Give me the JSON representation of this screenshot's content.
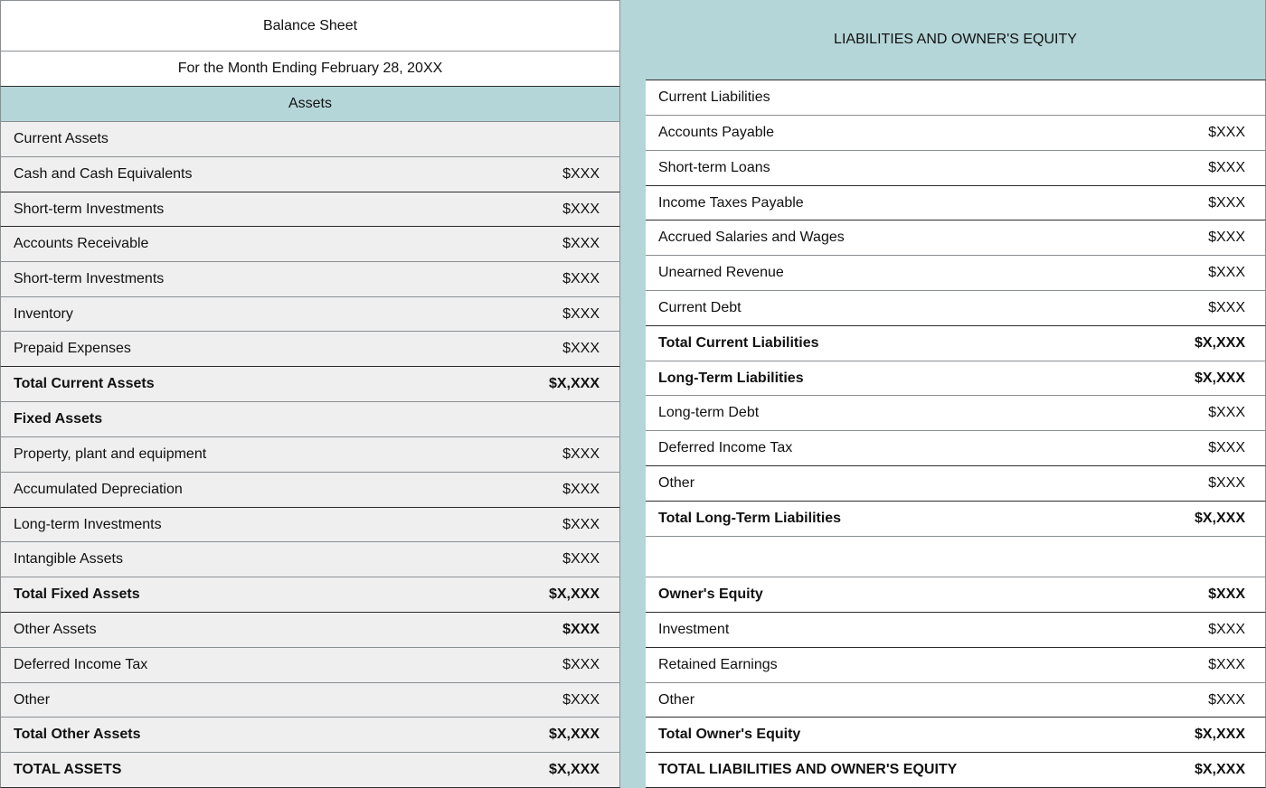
{
  "left": {
    "title": "Balance Sheet",
    "subtitle": "For the Month Ending February 28, 20XX",
    "section_header": "Assets",
    "rows": [
      {
        "label": "Current Assets",
        "value": ""
      },
      {
        "label": "Cash and Cash Equivalents",
        "value": "$XXX"
      },
      {
        "label": "Short-term Investments",
        "value": "$XXX"
      },
      {
        "label": "Accounts Receivable",
        "value": "$XXX"
      },
      {
        "label": "Short-term Investments",
        "value": "$XXX"
      },
      {
        "label": "Inventory",
        "value": "$XXX"
      },
      {
        "label": "Prepaid Expenses",
        "value": "$XXX"
      },
      {
        "label": "Total Current Assets",
        "value": "$X,XXX"
      },
      {
        "label": "Fixed Assets",
        "value": ""
      },
      {
        "label": "Property, plant and equipment",
        "value": "$XXX"
      },
      {
        "label": "Accumulated Depreciation",
        "value": "$XXX"
      },
      {
        "label": "Long-term Investments",
        "value": "$XXX"
      },
      {
        "label": "Intangible Assets",
        "value": "$XXX"
      },
      {
        "label": "Total Fixed Assets",
        "value": "$X,XXX"
      },
      {
        "label": "Other Assets",
        "value": "$XXX"
      },
      {
        "label": "Deferred Income Tax",
        "value": "$XXX"
      },
      {
        "label": "Other",
        "value": "$XXX"
      },
      {
        "label": "Total Other Assets",
        "value": "$X,XXX"
      },
      {
        "label": "TOTAL ASSETS",
        "value": "$X,XXX"
      }
    ]
  },
  "right": {
    "section_header": "LIABILITIES AND OWNER'S EQUITY",
    "rows": [
      {
        "label": "Current Liabilities",
        "value": ""
      },
      {
        "label": "Accounts Payable",
        "value": "$XXX"
      },
      {
        "label": "Short-term Loans",
        "value": "$XXX"
      },
      {
        "label": "Income Taxes Payable",
        "value": "$XXX"
      },
      {
        "label": "Accrued Salaries and Wages",
        "value": "$XXX"
      },
      {
        "label": "Unearned Revenue",
        "value": "$XXX"
      },
      {
        "label": "Current Debt",
        "value": "$XXX"
      },
      {
        "label": "Total Current Liabilities",
        "value": "$X,XXX"
      },
      {
        "label": "Long-Term Liabilities",
        "value": "$X,XXX"
      },
      {
        "label": "Long-term Debt",
        "value": "$XXX"
      },
      {
        "label": "Deferred Income Tax",
        "value": "$XXX"
      },
      {
        "label": "Other",
        "value": "$XXX"
      },
      {
        "label": "Total Long-Term Liabilities",
        "value": "$X,XXX"
      },
      {
        "label": "",
        "value": ""
      },
      {
        "label": "Owner's Equity",
        "value": "$XXX"
      },
      {
        "label": "Investment",
        "value": "$XXX"
      },
      {
        "label": "Retained Earnings",
        "value": "$XXX"
      },
      {
        "label": "Other",
        "value": "$XXX"
      },
      {
        "label": "Total Owner's Equity",
        "value": "$X,XXX"
      },
      {
        "label": "TOTAL LIABILITIES AND OWNER'S EQUITY",
        "value": "$X,XXX"
      }
    ]
  }
}
